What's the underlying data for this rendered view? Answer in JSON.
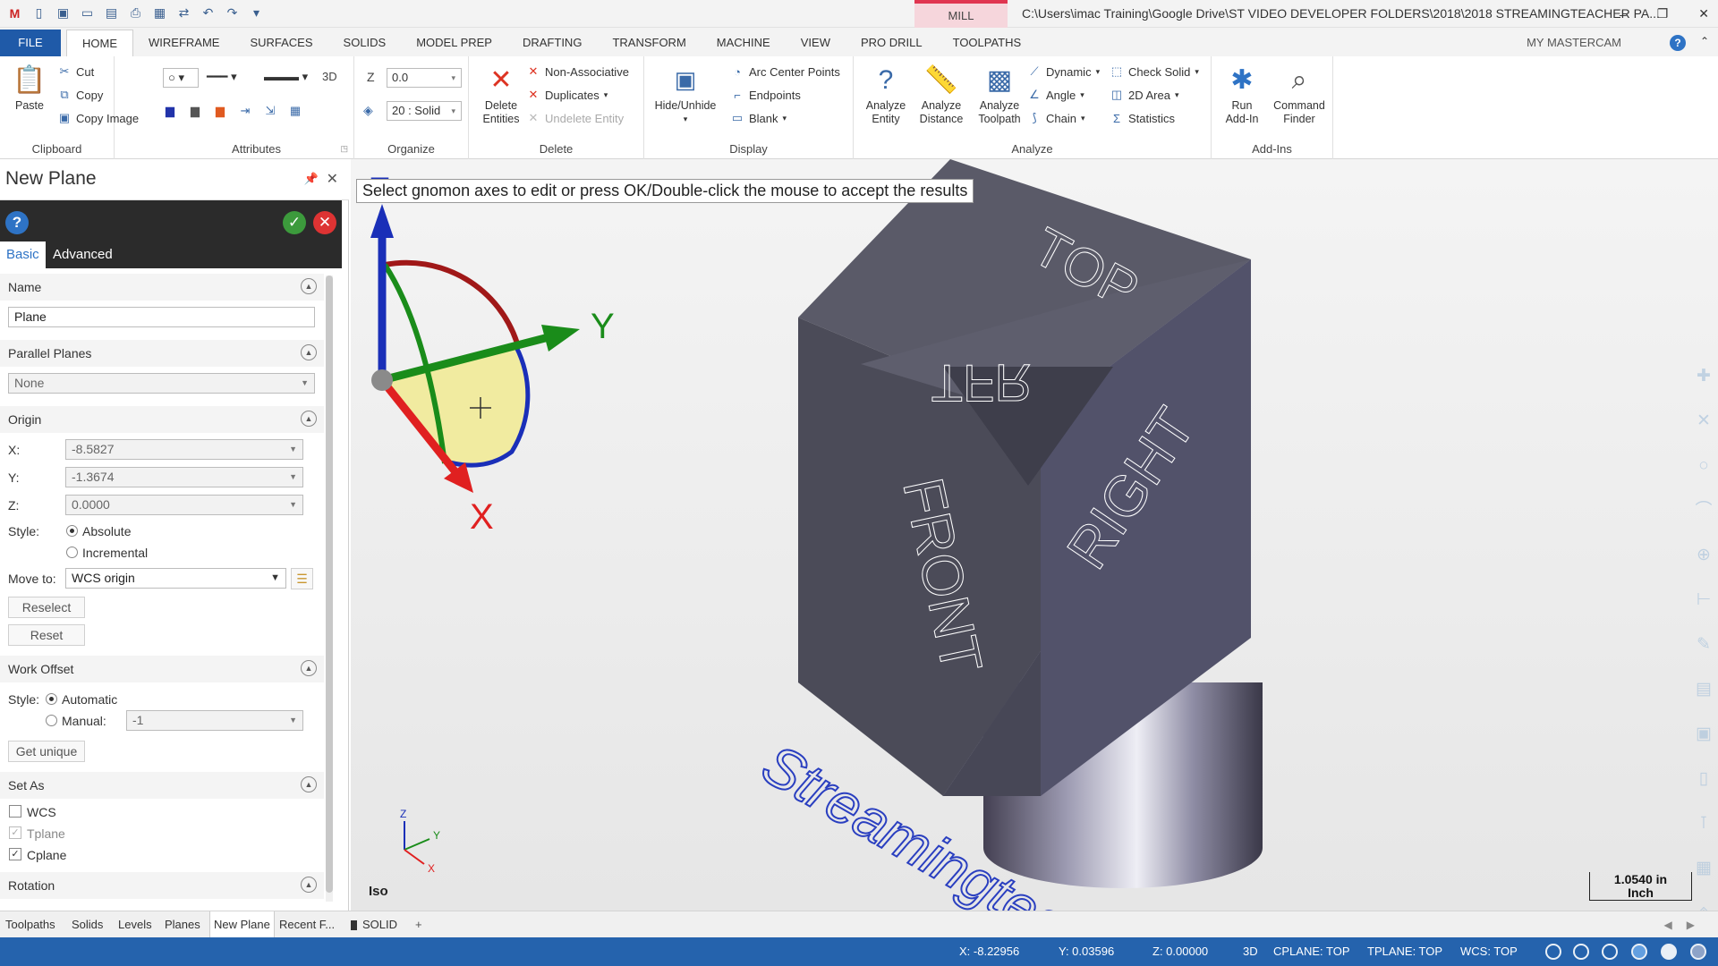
{
  "app": {
    "context_tab": "MILL",
    "window_title": "C:\\Users\\imac Training\\Google Drive\\ST VIDEO DEVELOPER FOLDERS\\2018\\2018 STREAMINGTEACHER PA...",
    "my_mastercam": "MY MASTERCAM",
    "help": "?"
  },
  "ribbon_tabs": [
    "FILE",
    "HOME",
    "WIREFRAME",
    "SURFACES",
    "SOLIDS",
    "MODEL PREP",
    "DRAFTING",
    "TRANSFORM",
    "MACHINE",
    "VIEW",
    "PRO DRILL",
    "TOOLPATHS"
  ],
  "active_tab": "HOME",
  "clipboard": {
    "paste": "Paste",
    "cut": "Cut",
    "copy": "Copy",
    "copy_image": "Copy Image",
    "label": "Clipboard"
  },
  "attributes": {
    "label": "Attributes",
    "mode": "3D"
  },
  "organize": {
    "z_label": "Z",
    "z_value": "0.0",
    "level": "20 : Solid",
    "label": "Organize"
  },
  "delete": {
    "delete_entities": "Delete\nEntities",
    "non_associative": "Non-Associative",
    "duplicates": "Duplicates",
    "undelete": "Undelete Entity",
    "label": "Delete"
  },
  "display": {
    "hide_unhide": "Hide/Unhide",
    "arc_center": "Arc Center Points",
    "endpoints": "Endpoints",
    "blank": "Blank",
    "label": "Display"
  },
  "analyze": {
    "entity": "Analyze\nEntity",
    "distance": "Analyze\nDistance",
    "toolpath": "Analyze\nToolpath",
    "dynamic": "Dynamic",
    "angle": "Angle",
    "chain": "Chain",
    "check_solid": "Check Solid",
    "area_2d": "2D Area",
    "statistics": "Statistics",
    "label": "Analyze"
  },
  "addins": {
    "run": "Run\nAdd-In",
    "command_finder": "Command\nFinder",
    "label": "Add-Ins"
  },
  "panel": {
    "title": "New Plane",
    "tabs": [
      "Basic",
      "Advanced"
    ],
    "name_section": "Name",
    "name_value": "Plane",
    "parallel_section": "Parallel Planes",
    "parallel_value": "None",
    "origin_section": "Origin",
    "x_label": "X:",
    "x_value": "-8.5827",
    "y_label": "Y:",
    "y_value": "-1.3674",
    "z_label": "Z:",
    "z_value": "0.0000",
    "style_label": "Style:",
    "absolute": "Absolute",
    "incremental": "Incremental",
    "move_to_label": "Move to:",
    "move_to_value": "WCS origin",
    "reselect": "Reselect",
    "reset": "Reset",
    "work_offset_section": "Work Offset",
    "wo_style_label": "Style:",
    "automatic": "Automatic",
    "manual": "Manual:",
    "manual_value": "-1",
    "get_unique": "Get unique",
    "set_as_section": "Set As",
    "wcs": "WCS",
    "tplane": "Tplane",
    "cplane": "Cplane",
    "rotation_section": "Rotation"
  },
  "viewport": {
    "prompt": "Select gnomon axes to edit or press OK/Double-click the mouse to accept the results",
    "axis_x": "X",
    "axis_y": "Y",
    "axis_z": "Z",
    "cube_top": "TOP",
    "cube_front": "FRONT",
    "cube_right": "RIGHT",
    "cube_corner": "TFR",
    "watermark": "Streamingteac",
    "view_name": "Iso",
    "scale_value": "1.0540 in",
    "scale_unit": "Inch",
    "mini_x": "X",
    "mini_y": "Y",
    "mini_z": "Z"
  },
  "bottom_tabs": [
    "Toolpaths",
    "Solids",
    "Levels",
    "Planes",
    "New Plane",
    "Recent F..."
  ],
  "bottom_active": "New Plane",
  "solid_tab": "SOLID",
  "add_tab": "+",
  "status": {
    "x": "X:   -8.22956",
    "y": "Y:   0.03596",
    "z": "Z:   0.00000",
    "mode": "3D",
    "cplane": "CPLANE: TOP",
    "tplane": "TPLANE: TOP",
    "wcs": "WCS: TOP"
  },
  "colors": {
    "accent": "#1f5aa8",
    "status_bar": "#2563ad",
    "axis_x": "#e02020",
    "axis_y": "#1a8c1a",
    "axis_z": "#1a2fb8",
    "cube": "#4c4c5a",
    "highlight": "#f2eca0"
  }
}
